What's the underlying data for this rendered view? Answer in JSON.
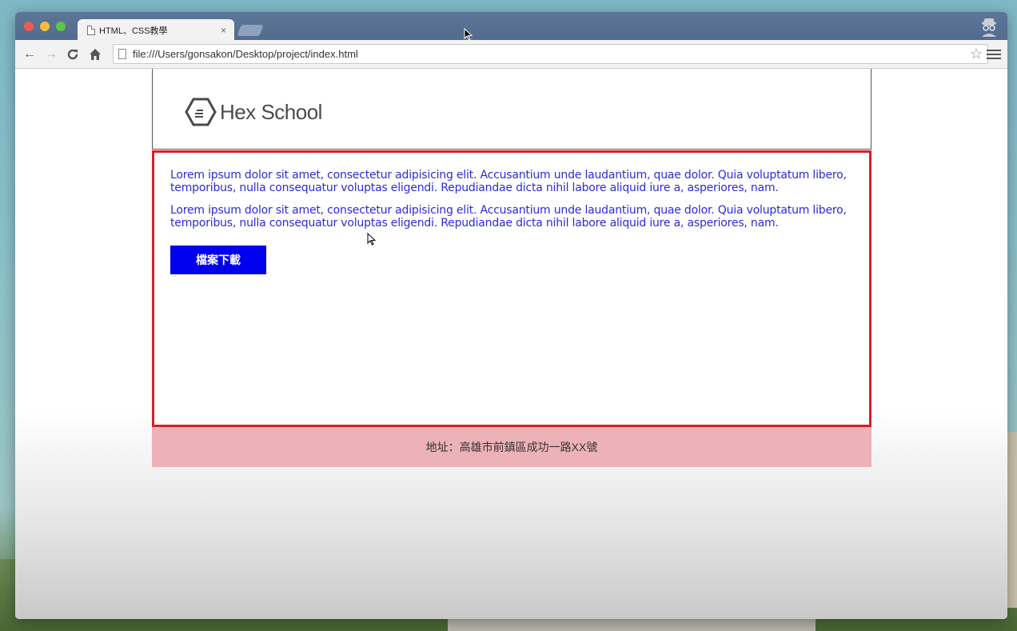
{
  "browser": {
    "tab_title": "HTML、CSS教學",
    "tab_close": "×",
    "url": "file:///Users/gonsakon/Desktop/project/index.html",
    "icons": {
      "back": "←",
      "forward": "→",
      "reload": "C",
      "home": "⌂",
      "star": "☆"
    }
  },
  "page": {
    "logo_text": "Hex School",
    "paragraphs": [
      "Lorem ipsum dolor sit amet, consectetur adipisicing elit. Accusantium unde laudantium, quae dolor. Quia voluptatum libero, temporibus, nulla consequatur voluptas eligendi. Repudiandae dicta nihil labore aliquid iure a, asperiores, nam.",
      "Lorem ipsum dolor sit amet, consectetur adipisicing elit. Accusantium unde laudantium, quae dolor. Quia voluptatum libero, temporibus, nulla consequatur voluptas eligendi. Repudiandae dicta nihil labore aliquid iure a, asperiores, nam."
    ],
    "download_button": "檔案下載",
    "footer_address": "地址：高雄市前鎮區成功一路XX號"
  },
  "colors": {
    "content_border": "#d91f26",
    "text": "#2b2bd9",
    "button_bg": "#0000ee",
    "footer_bg": "#ecb2b7"
  }
}
